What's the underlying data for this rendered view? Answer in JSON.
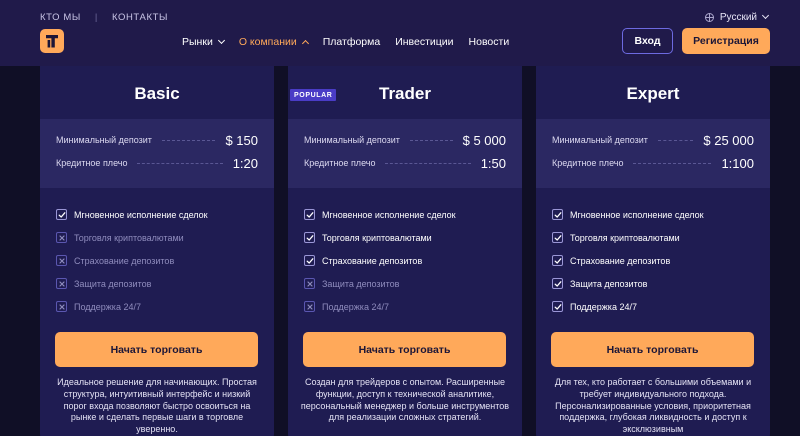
{
  "header": {
    "top_links": [
      "КТО МЫ",
      "КОНТАКТЫ"
    ],
    "top_separator": "|",
    "language": "Русский",
    "nav": [
      {
        "label": "Рынки",
        "dropdown": true,
        "active": false
      },
      {
        "label": "О компании",
        "dropdown": true,
        "active": true
      },
      {
        "label": "Платформа",
        "dropdown": false,
        "active": false
      },
      {
        "label": "Инвестиции",
        "dropdown": false,
        "active": false
      },
      {
        "label": "Новости",
        "dropdown": false,
        "active": false
      }
    ],
    "login_label": "Вход",
    "register_label": "Регистрация"
  },
  "plans": [
    {
      "title": "Basic",
      "badge": "",
      "deposit_label": "Минимальный депозит",
      "deposit_value": "$ 150",
      "leverage_label": "Кредитное плечо",
      "leverage_value": "1:20",
      "features": [
        {
          "label": "Мгновенное исполнение сделок",
          "included": true
        },
        {
          "label": "Торговля криптовалютами",
          "included": false
        },
        {
          "label": "Страхование депозитов",
          "included": false
        },
        {
          "label": "Защита депозитов",
          "included": false
        },
        {
          "label": "Поддержка 24/7",
          "included": false
        }
      ],
      "cta": "Начать торговать",
      "description": "Идеальное решение для начинающих. Простая структура, интуитивный интерфейс и низкий порог входа позволяют быстро освоиться на рынке и сделать первые шаги в торговле уверенно."
    },
    {
      "title": "Trader",
      "badge": "POPULAR",
      "deposit_label": "Минимальный депозит",
      "deposit_value": "$ 5 000",
      "leverage_label": "Кредитное плечо",
      "leverage_value": "1:50",
      "features": [
        {
          "label": "Мгновенное исполнение сделок",
          "included": true
        },
        {
          "label": "Торговля криптовалютами",
          "included": true
        },
        {
          "label": "Страхование депозитов",
          "included": true
        },
        {
          "label": "Защита депозитов",
          "included": false
        },
        {
          "label": "Поддержка 24/7",
          "included": false
        }
      ],
      "cta": "Начать торговать",
      "description": "Создан для трейдеров с опытом. Расширенные функции, доступ к технической аналитике, персональный менеджер и больше инструментов для реализации сложных стратегий."
    },
    {
      "title": "Expert",
      "badge": "",
      "deposit_label": "Минимальный депозит",
      "deposit_value": "$ 25 000",
      "leverage_label": "Кредитное плечо",
      "leverage_value": "1:100",
      "features": [
        {
          "label": "Мгновенное исполнение сделок",
          "included": true
        },
        {
          "label": "Торговля криптовалютами",
          "included": true
        },
        {
          "label": "Страхование депозитов",
          "included": true
        },
        {
          "label": "Защита депозитов",
          "included": true
        },
        {
          "label": "Поддержка 24/7",
          "included": true
        }
      ],
      "cta": "Начать торговать",
      "description": "Для тех, кто работает с большими объемами и требует индивидуального подхода. Персонализированные условия, приоритетная поддержка, глубокая ликвидность и доступ к эксклюзивным"
    }
  ],
  "colors": {
    "accent": "#ffa95a",
    "header_bg": "#201a4a",
    "page_bg": "#100f26",
    "card_bg": "#1f1c52",
    "summary_bg": "#2b2862",
    "badge_bg": "#4a3cc6"
  },
  "icons": {
    "logo": "brand-logo-icon",
    "language": "globe-icon",
    "included": "check-icon",
    "excluded": "cross-icon"
  }
}
